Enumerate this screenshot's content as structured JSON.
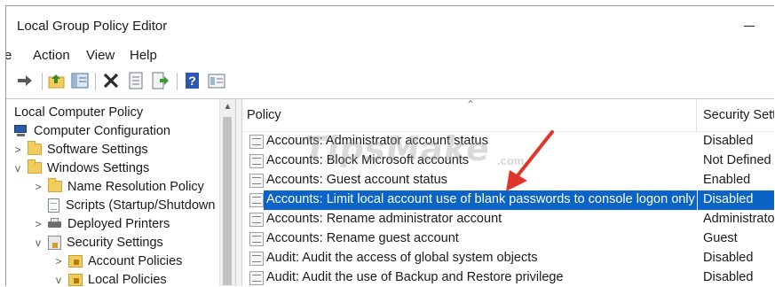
{
  "window": {
    "title": "Local Group Policy Editor"
  },
  "menu": {
    "items": [
      "Action",
      "View",
      "Help"
    ],
    "truncated_prefix": "e"
  },
  "toolbar": {
    "icons": [
      "forward-arrow-icon",
      "up-folder-icon",
      "show-hide-tree-icon",
      "delete-icon",
      "properties-icon",
      "export-icon",
      "help-icon",
      "details-view-icon"
    ]
  },
  "tree": {
    "items": [
      {
        "label": "Local Computer Policy",
        "level": 0,
        "icon": "none",
        "chevron": ""
      },
      {
        "label": "Computer Configuration",
        "level": 0,
        "icon": "computer-icon",
        "chevron": ""
      },
      {
        "label": "Software Settings",
        "level": 1,
        "icon": "folder-icon",
        "chevron": ">"
      },
      {
        "label": "Windows Settings",
        "level": 1,
        "icon": "folder-icon",
        "chevron": "v"
      },
      {
        "label": "Name Resolution Policy",
        "level": 2,
        "icon": "folder-icon",
        "chevron": ">"
      },
      {
        "label": "Scripts (Startup/Shutdown",
        "level": 2,
        "icon": "script-icon",
        "chevron": ""
      },
      {
        "label": "Deployed Printers",
        "level": 2,
        "icon": "printer-icon",
        "chevron": ">"
      },
      {
        "label": "Security Settings",
        "level": 2,
        "icon": "security-icon",
        "chevron": "v"
      },
      {
        "label": "Account Policies",
        "level": 3,
        "icon": "lock-folder-icon",
        "chevron": ">"
      },
      {
        "label": "Local Policies",
        "level": 3,
        "icon": "lock-folder-icon",
        "chevron": "v"
      }
    ]
  },
  "list": {
    "columns": {
      "policy": "Policy",
      "setting": "Security Setti"
    },
    "rows": [
      {
        "policy": "Accounts: Administrator account status",
        "setting": "Disabled"
      },
      {
        "policy": "Accounts: Block Microsoft accounts",
        "setting": "Not Defined"
      },
      {
        "policy": "Accounts: Guest account status",
        "setting": "Enabled"
      },
      {
        "policy": "Accounts: Limit local account use of blank passwords to console logon only",
        "setting": "Disabled"
      },
      {
        "policy": "Accounts: Rename administrator account",
        "setting": "Administrato"
      },
      {
        "policy": "Accounts: Rename guest account",
        "setting": "Guest"
      },
      {
        "policy": "Audit: Audit the access of global system objects",
        "setting": "Disabled"
      },
      {
        "policy": "Audit: Audit the use of Backup and Restore privilege",
        "setting": "Disabled"
      }
    ],
    "selected_index": 3
  },
  "watermark": {
    "text": "TipsMake",
    "suffix": ".com"
  },
  "colors": {
    "selection": "#0a64c8",
    "annotation_arrow": "#e0352b"
  }
}
